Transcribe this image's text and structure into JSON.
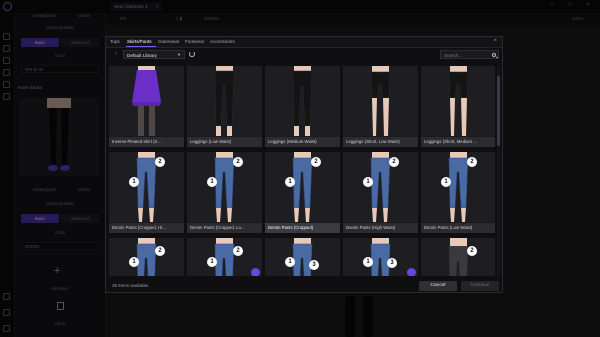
{
  "window": {
    "doc_tab": "New Character 1",
    "controls": "— ☐ ✕"
  },
  "toolbar": {
    "frame_value": "FR",
    "color_value": "000000",
    "zoom": "100%"
  },
  "left_panel": {
    "top_buttons": [
      "Unassigned",
      "Visual"
    ],
    "top_label": "Coloring Mode",
    "mode_buttons": [
      "Basic",
      "Advanced"
    ],
    "color_label": "Color",
    "color_value": "000 ID ID",
    "section_title": "Knee Socks",
    "mid_buttons": [
      "Unassigned",
      "Visual"
    ],
    "mid_label": "Coloring Mode",
    "mode_buttons_2": [
      "Basic",
      "Advanced"
    ],
    "color_label_2": "Color",
    "color_value_2": "000000",
    "add_label": "Add Item",
    "delete_label": "Clear"
  },
  "modal": {
    "tabs": [
      "Tops",
      "Skirts/Pants",
      "Outerwear",
      "Footwear",
      "Accessories"
    ],
    "active_tab": "Skirts/Pants",
    "library": "Default Library",
    "search_placeholder": "Search...",
    "items_count": "35 items available.",
    "cancel_label": "Cancel",
    "continue_label": "Continue",
    "items": [
      {
        "caption": "Inverse-Pleated Skirt (S...",
        "kind": "skirt"
      },
      {
        "caption": "Leggings (Low Waist)",
        "kind": "leggings"
      },
      {
        "caption": "Leggings (Medium Waist)",
        "kind": "leggings"
      },
      {
        "caption": "Leggings (Short, Low Waist)",
        "kind": "shorts"
      },
      {
        "caption": "Leggings (Short, Medium ...",
        "kind": "shorts"
      },
      {
        "caption": "Denim Pants (Cropped, Hi...",
        "kind": "denim"
      },
      {
        "caption": "Denim Pants (Cropped, Lo...",
        "kind": "denim"
      },
      {
        "caption": "Denim Pants (Cropped)",
        "kind": "denim",
        "selected": true
      },
      {
        "caption": "Denim Pants (High Waist)",
        "kind": "denim"
      },
      {
        "caption": "Denim Pants (Low Waist)",
        "kind": "denim"
      },
      {
        "caption": "",
        "kind": "denim-partial"
      },
      {
        "caption": "",
        "kind": "denim-partial"
      },
      {
        "caption": "",
        "kind": "denim-partial"
      },
      {
        "caption": "",
        "kind": "denim-partial"
      },
      {
        "caption": "",
        "kind": "grey-partial"
      }
    ],
    "badge_1": "1",
    "badge_2": "2",
    "badge_3": "3"
  },
  "colors": {
    "accent": "#6a45e0",
    "skirt": "#6b2fc8",
    "denim": "#4a6aa4",
    "legging": "#141414"
  }
}
